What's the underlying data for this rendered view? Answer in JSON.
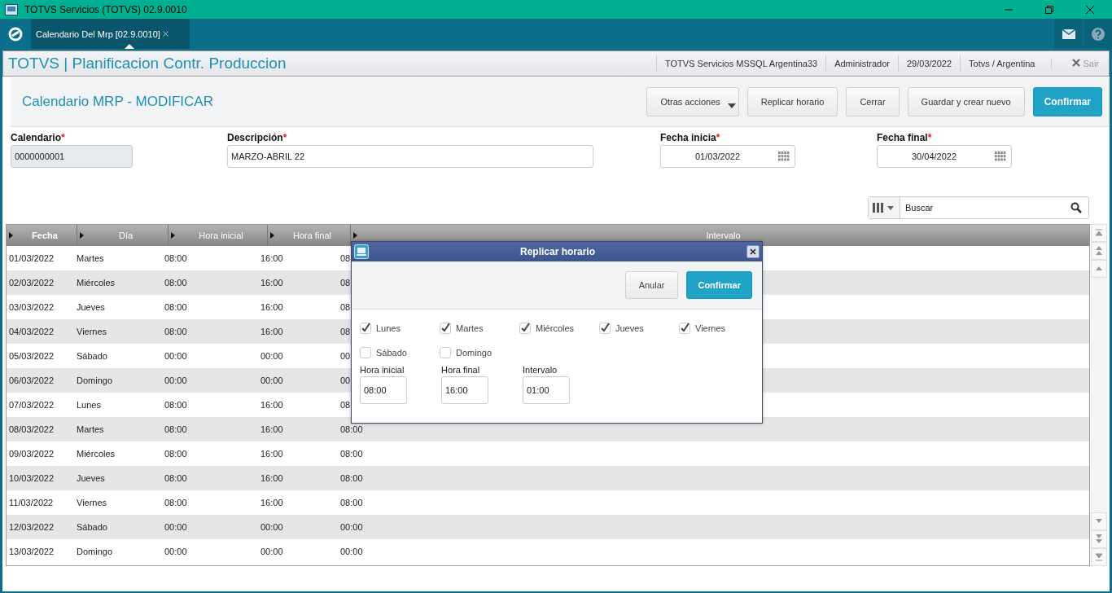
{
  "window": {
    "title": "TOTVS Servicios (TOTVS) 02.9.0010"
  },
  "tabs": [
    {
      "label": "Calendario Del Mrp [02.9.0010]",
      "selected": true
    }
  ],
  "header": {
    "app_title": "TOTVS | Planificacion Contr. Produccion",
    "info": [
      "TOTVS Servicios MSSQL Argentina33",
      "Administrador",
      "29/03/2022",
      "Totvs / Argentina"
    ],
    "exit": "Sair"
  },
  "page_title": "Calendario MRP - MODIFICAR",
  "actions": [
    {
      "label": "Otras acciones",
      "kind": "menu"
    },
    {
      "label": "Replicar horario",
      "kind": "normal"
    },
    {
      "label": "Cerrar",
      "kind": "normal"
    },
    {
      "label": "Guardar y crear nuevo",
      "kind": "normal"
    },
    {
      "label": "Confirmar",
      "kind": "primary"
    }
  ],
  "fields": [
    {
      "label": "Calendario",
      "required_mark": "*",
      "value": "0000000001",
      "kind": "readonly"
    },
    {
      "label": "Descripción",
      "required_mark": "*",
      "value": "MARZO-ABRIL 22",
      "kind": "text"
    },
    {
      "label": "Fecha inicia",
      "required_mark": "*",
      "value": "01/03/2022",
      "kind": "date"
    },
    {
      "label": "Fecha final",
      "required_mark": "*",
      "value": "30/04/2022",
      "kind": "date"
    }
  ],
  "search": {
    "placeholder": "Buscar"
  },
  "table": {
    "columns": [
      "Fecha",
      "Día",
      "Hora inicial",
      "Hora final",
      "Intervalo"
    ],
    "rows": [
      [
        "01/03/2022",
        "Martes",
        "08:00",
        "16:00",
        "08"
      ],
      [
        "02/03/2022",
        "Miércoles",
        "08:00",
        "16:00",
        "08"
      ],
      [
        "03/03/2022",
        "Jueves",
        "08:00",
        "16:00",
        "08"
      ],
      [
        "04/03/2022",
        "Viernes",
        "08:00",
        "16:00",
        "08"
      ],
      [
        "05/03/2022",
        "Sábado",
        "00:00",
        "00:00",
        "00"
      ],
      [
        "06/03/2022",
        "Domingo",
        "00:00",
        "00:00",
        "00"
      ],
      [
        "07/03/2022",
        "Lunes",
        "08:00",
        "16:00",
        "08"
      ],
      [
        "08/03/2022",
        "Martes",
        "08:00",
        "16:00",
        "08:00"
      ],
      [
        "09/03/2022",
        "Miércoles",
        "08:00",
        "16:00",
        "08:00"
      ],
      [
        "10/03/2022",
        "Jueves",
        "08:00",
        "16:00",
        "08:00"
      ],
      [
        "11/03/2022",
        "Viernes",
        "08:00",
        "16:00",
        "08:00"
      ],
      [
        "12/03/2022",
        "Sábado",
        "00:00",
        "00:00",
        "00:00"
      ],
      [
        "13/03/2022",
        "Domingo",
        "00:00",
        "00:00",
        "00:00"
      ]
    ]
  },
  "dialog": {
    "title": "Replicar horario",
    "buttons": [
      {
        "label": "Anular",
        "kind": "normal"
      },
      {
        "label": "Confirmar",
        "kind": "primary"
      }
    ],
    "days": [
      {
        "label": "Lunes",
        "checked": true
      },
      {
        "label": "Martes",
        "checked": true
      },
      {
        "label": "Miércoles",
        "checked": true
      },
      {
        "label": "Jueves",
        "checked": true
      },
      {
        "label": "Viernes",
        "checked": true
      },
      {
        "label": "Sábado",
        "checked": false
      },
      {
        "label": "Domingo",
        "checked": false
      }
    ],
    "fields": [
      {
        "label": "Hora inicial",
        "value": "08:00"
      },
      {
        "label": "Hora final",
        "value": "16:00"
      },
      {
        "label": "Intervalo",
        "value": "01:00"
      }
    ]
  }
}
